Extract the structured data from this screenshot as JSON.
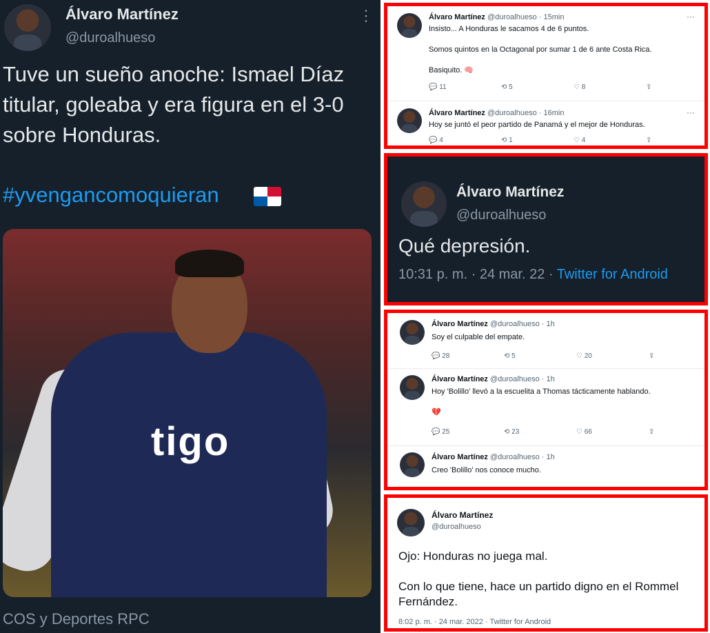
{
  "main_tweet": {
    "name": "Álvaro Martínez",
    "handle": "@duroalhueso",
    "more": "⋮",
    "text": "Tuve un sueño anoche: Ismael Díaz titular, goleaba y era figura en el 3-0 sobre Honduras.",
    "hashtag": "#yvengancomoquieran",
    "photo_logo": "tigo",
    "credit": "COS y Deportes RPC"
  },
  "panel1": {
    "tweets": [
      {
        "name": "Álvaro Martínez",
        "meta": "@duroalhueso · 15min",
        "text": "Insisto... A Honduras le sacamos 4 de 6 puntos.\n\nSomos quintos en la Octagonal por sumar 1 de 6 ante Costa Rica.\n\nBasiquito. 🧠",
        "replies": "11",
        "retweets": "5",
        "likes": "8"
      },
      {
        "name": "Álvaro Martínez",
        "meta": "@duroalhueso · 16min",
        "text": "Hoy se juntó el peor partido de Panamá y el mejor de Honduras.",
        "replies": "4",
        "retweets": "1",
        "likes": "4"
      }
    ]
  },
  "panel2": {
    "name": "Álvaro Martínez",
    "handle": "@duroalhueso",
    "text": "Qué depresión.",
    "time": "10:31 p. m. · 24 mar. 22 · ",
    "source": "Twitter for Android"
  },
  "panel3": {
    "tweets": [
      {
        "name": "Álvaro Martínez",
        "meta": "@duroalhueso · 1h",
        "text": "Soy el culpable del empate.",
        "replies": "28",
        "retweets": "5",
        "likes": "20"
      },
      {
        "name": "Álvaro Martínez",
        "meta": "@duroalhueso · 1h",
        "text": "Hoy 'Bolillo' llevó a la escuelita a Thomas tácticamente hablando.\n\n💔",
        "replies": "25",
        "retweets": "23",
        "likes": "66"
      },
      {
        "name": "Álvaro Martínez",
        "meta": "@duroalhueso · 1h",
        "text": "Creo 'Bolillo' nos conoce mucho."
      }
    ]
  },
  "panel4": {
    "name": "Álvaro Martínez",
    "handle": "@duroalhueso",
    "text": "Ojo: Honduras no juega mal.\n\nCon lo que tiene, hace un partido digno en el Rommel Fernández.",
    "footer": "8:02 p. m. · 24 mar. 2022 · Twitter for Android"
  },
  "icons": {
    "reply": "reply-icon",
    "retweet": "retweet-icon",
    "like": "like-icon",
    "share": "share-icon",
    "more": "more-icon"
  }
}
